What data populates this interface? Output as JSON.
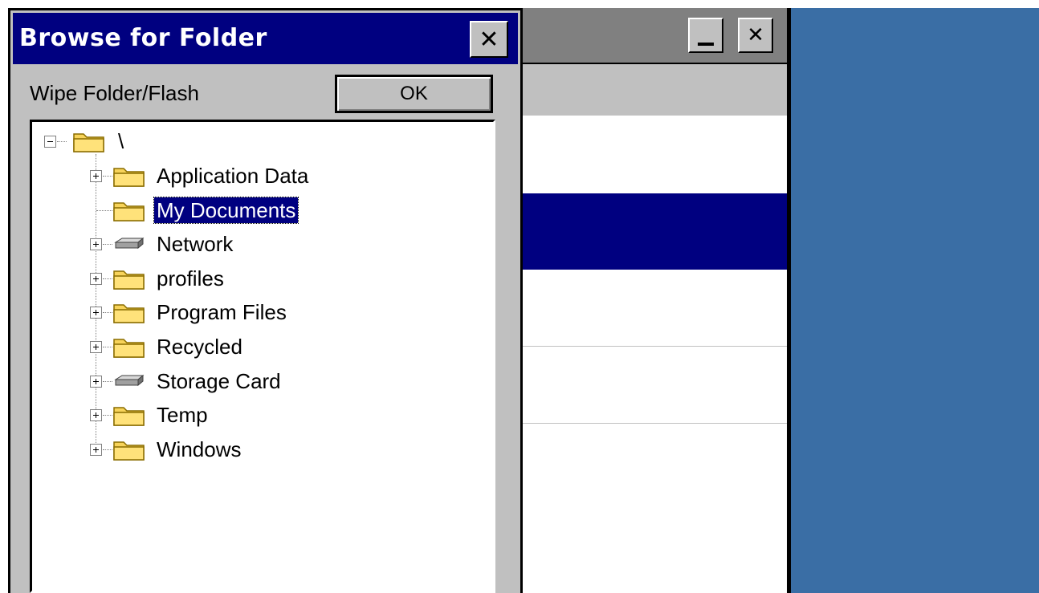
{
  "dialog": {
    "title": "Browse for Folder",
    "close_glyph": "✕",
    "label": "Wipe Folder/Flash",
    "ok_label": "OK"
  },
  "tree": {
    "root": {
      "label": "\\",
      "expanded": true,
      "icon": "folder-icon"
    },
    "items": [
      {
        "label": "Application Data",
        "icon": "folder-icon",
        "expandable": true,
        "selected": false
      },
      {
        "label": "My Documents",
        "icon": "folder-icon",
        "expandable": false,
        "selected": true
      },
      {
        "label": "Network",
        "icon": "drive-icon",
        "expandable": true,
        "selected": false
      },
      {
        "label": "profiles",
        "icon": "folder-icon",
        "expandable": true,
        "selected": false
      },
      {
        "label": "Program Files",
        "icon": "folder-icon",
        "expandable": true,
        "selected": false
      },
      {
        "label": "Recycled",
        "icon": "folder-icon",
        "expandable": true,
        "selected": false
      },
      {
        "label": "Storage Card",
        "icon": "drive-icon",
        "expandable": true,
        "selected": false
      },
      {
        "label": "Temp",
        "icon": "folder-icon",
        "expandable": true,
        "selected": false
      },
      {
        "label": "Windows",
        "icon": "folder-icon",
        "expandable": true,
        "selected": false
      }
    ]
  },
  "background_window": {
    "minimize_glyph": "_",
    "close_glyph": "✕"
  },
  "colors": {
    "titlebar": "#000080",
    "selection": "#000080",
    "dialog_face": "#c0c0c0",
    "desktop": "#3a6ea5",
    "folder": "#f7d35a"
  }
}
